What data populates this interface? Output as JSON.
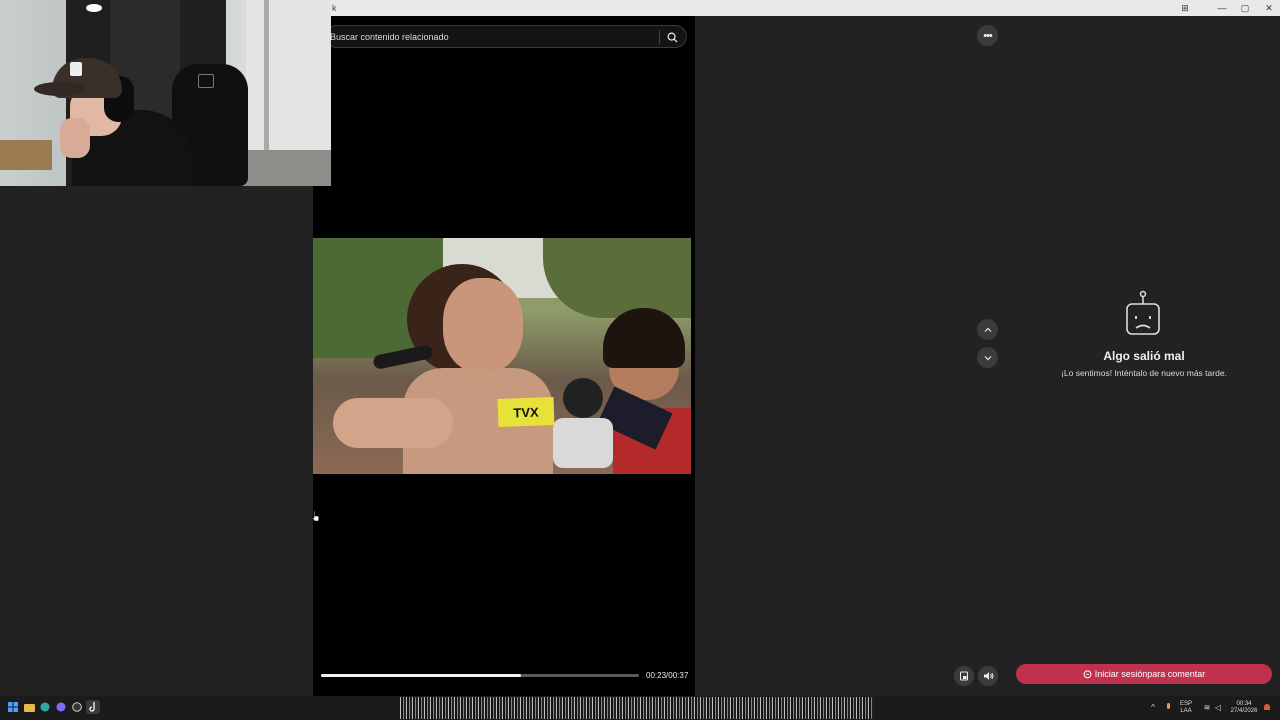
{
  "window": {
    "title": "k",
    "controls": [
      "minimize",
      "maximize",
      "close"
    ]
  },
  "search": {
    "placeholder": "Buscar contenido relacionado"
  },
  "video": {
    "overlay_text": "TVX",
    "progress_fraction": 0.63,
    "time_display": "00:23/00:37"
  },
  "comments_panel": {
    "error_title": "Algo salió mal",
    "error_message": "¡Lo sentimos! Inténtalo de nuevo más tarde.",
    "more_button_glyph": "•••"
  },
  "login_button": {
    "label": "Iniciar sesiónpara comentar"
  },
  "taskbar": {
    "language_line1": "ESP",
    "language_line2": "LAA",
    "time": "00:34",
    "date": "27/4/2026"
  },
  "colors": {
    "background": "#222222",
    "player_bg": "#000000",
    "accent": "#c0304f",
    "button_bg": "#3b3b3b"
  },
  "icons": [
    "search-icon",
    "more-icon",
    "chevron-up-icon",
    "chevron-down-icon",
    "sad-robot-icon",
    "mini-player-icon",
    "volume-icon",
    "comment-icon",
    "windows-start-icon"
  ]
}
